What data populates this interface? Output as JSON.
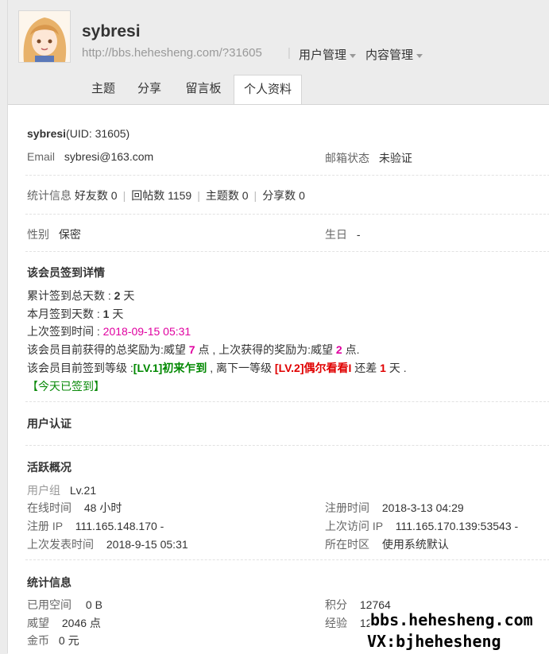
{
  "header": {
    "username": "sybresi",
    "url": "http://bbs.hehesheng.com/?31605",
    "separator": "|",
    "menu_user_mgmt": "用户管理",
    "menu_content_mgmt": "内容管理"
  },
  "tabs": [
    {
      "label": "主题"
    },
    {
      "label": "分享"
    },
    {
      "label": "留言板"
    },
    {
      "label": "个人资料",
      "active": true
    }
  ],
  "profile": {
    "name": "sybresi",
    "uid": "(UID: 31605)",
    "email_label": "Email",
    "email_value": "sybresi@163.com",
    "mail_status_label": "邮箱状态",
    "mail_status_value": "未验证",
    "stats_label": "统计信息",
    "friends": "好友数 0",
    "replies": "回帖数 1159",
    "topics": "主题数 0",
    "shares": "分享数 0",
    "gender_label": "性别",
    "gender_value": "保密",
    "birthday_label": "生日",
    "birthday_value": "-"
  },
  "signin": {
    "title": "该会员签到详情",
    "total_prefix": "累计签到总天数 : ",
    "total_days": "2",
    "total_suffix": " 天",
    "month_prefix": "本月签到天数 : ",
    "month_days": "1",
    "month_suffix": " 天",
    "last_prefix": "上次签到时间 : ",
    "last_time": "2018-09-15 05:31",
    "reward_prefix": "该会员目前获得的总奖励为:威望 ",
    "reward_total": "7",
    "reward_mid": " 点 , 上次获得的奖励为:威望 ",
    "reward_last": "2",
    "reward_suffix": " 点.",
    "level_prefix": "该会员目前签到等级 :",
    "level_current": "[LV.1]初来乍到",
    "level_mid": " , 离下一等级 ",
    "level_next": "[LV.2]偶尔看看I",
    "level_gap_prefix": " 还差 ",
    "level_gap": "1",
    "level_gap_suffix": " 天 .",
    "today_button": "【今天已签到】"
  },
  "auth": {
    "title": "用户认证"
  },
  "activity": {
    "title": "活跃概况",
    "group_label": "用户组",
    "group_value": "Lv.21",
    "online_label": "在线时间",
    "online_value": "48 小时",
    "reg_time_label": "注册时间",
    "reg_time_value": "2018-3-13 04:29",
    "reg_ip_label": "注册 IP",
    "reg_ip_value": "111.165.148.170 -",
    "last_visit_label": "上次访问 IP",
    "last_visit_value": "111.165.170.139:53543 -",
    "last_post_label": "上次发表时间",
    "last_post_value": "2018-9-15 05:31",
    "region_label": "所在时区",
    "region_value": "使用系统默认"
  },
  "statistics": {
    "title": "统计信息",
    "space_label": "已用空间",
    "space_value": "0 B",
    "points_label": "积分",
    "points_value": "12764",
    "prestige_label": "威望",
    "prestige_value": "2046 点",
    "exp_label": "经验",
    "exp_value": "12...",
    "coins_label": "金币",
    "coins_value": "0 元"
  },
  "watermark": {
    "line1": "bbs.hehesheng.com",
    "line2": "VX:bjhehesheng"
  }
}
